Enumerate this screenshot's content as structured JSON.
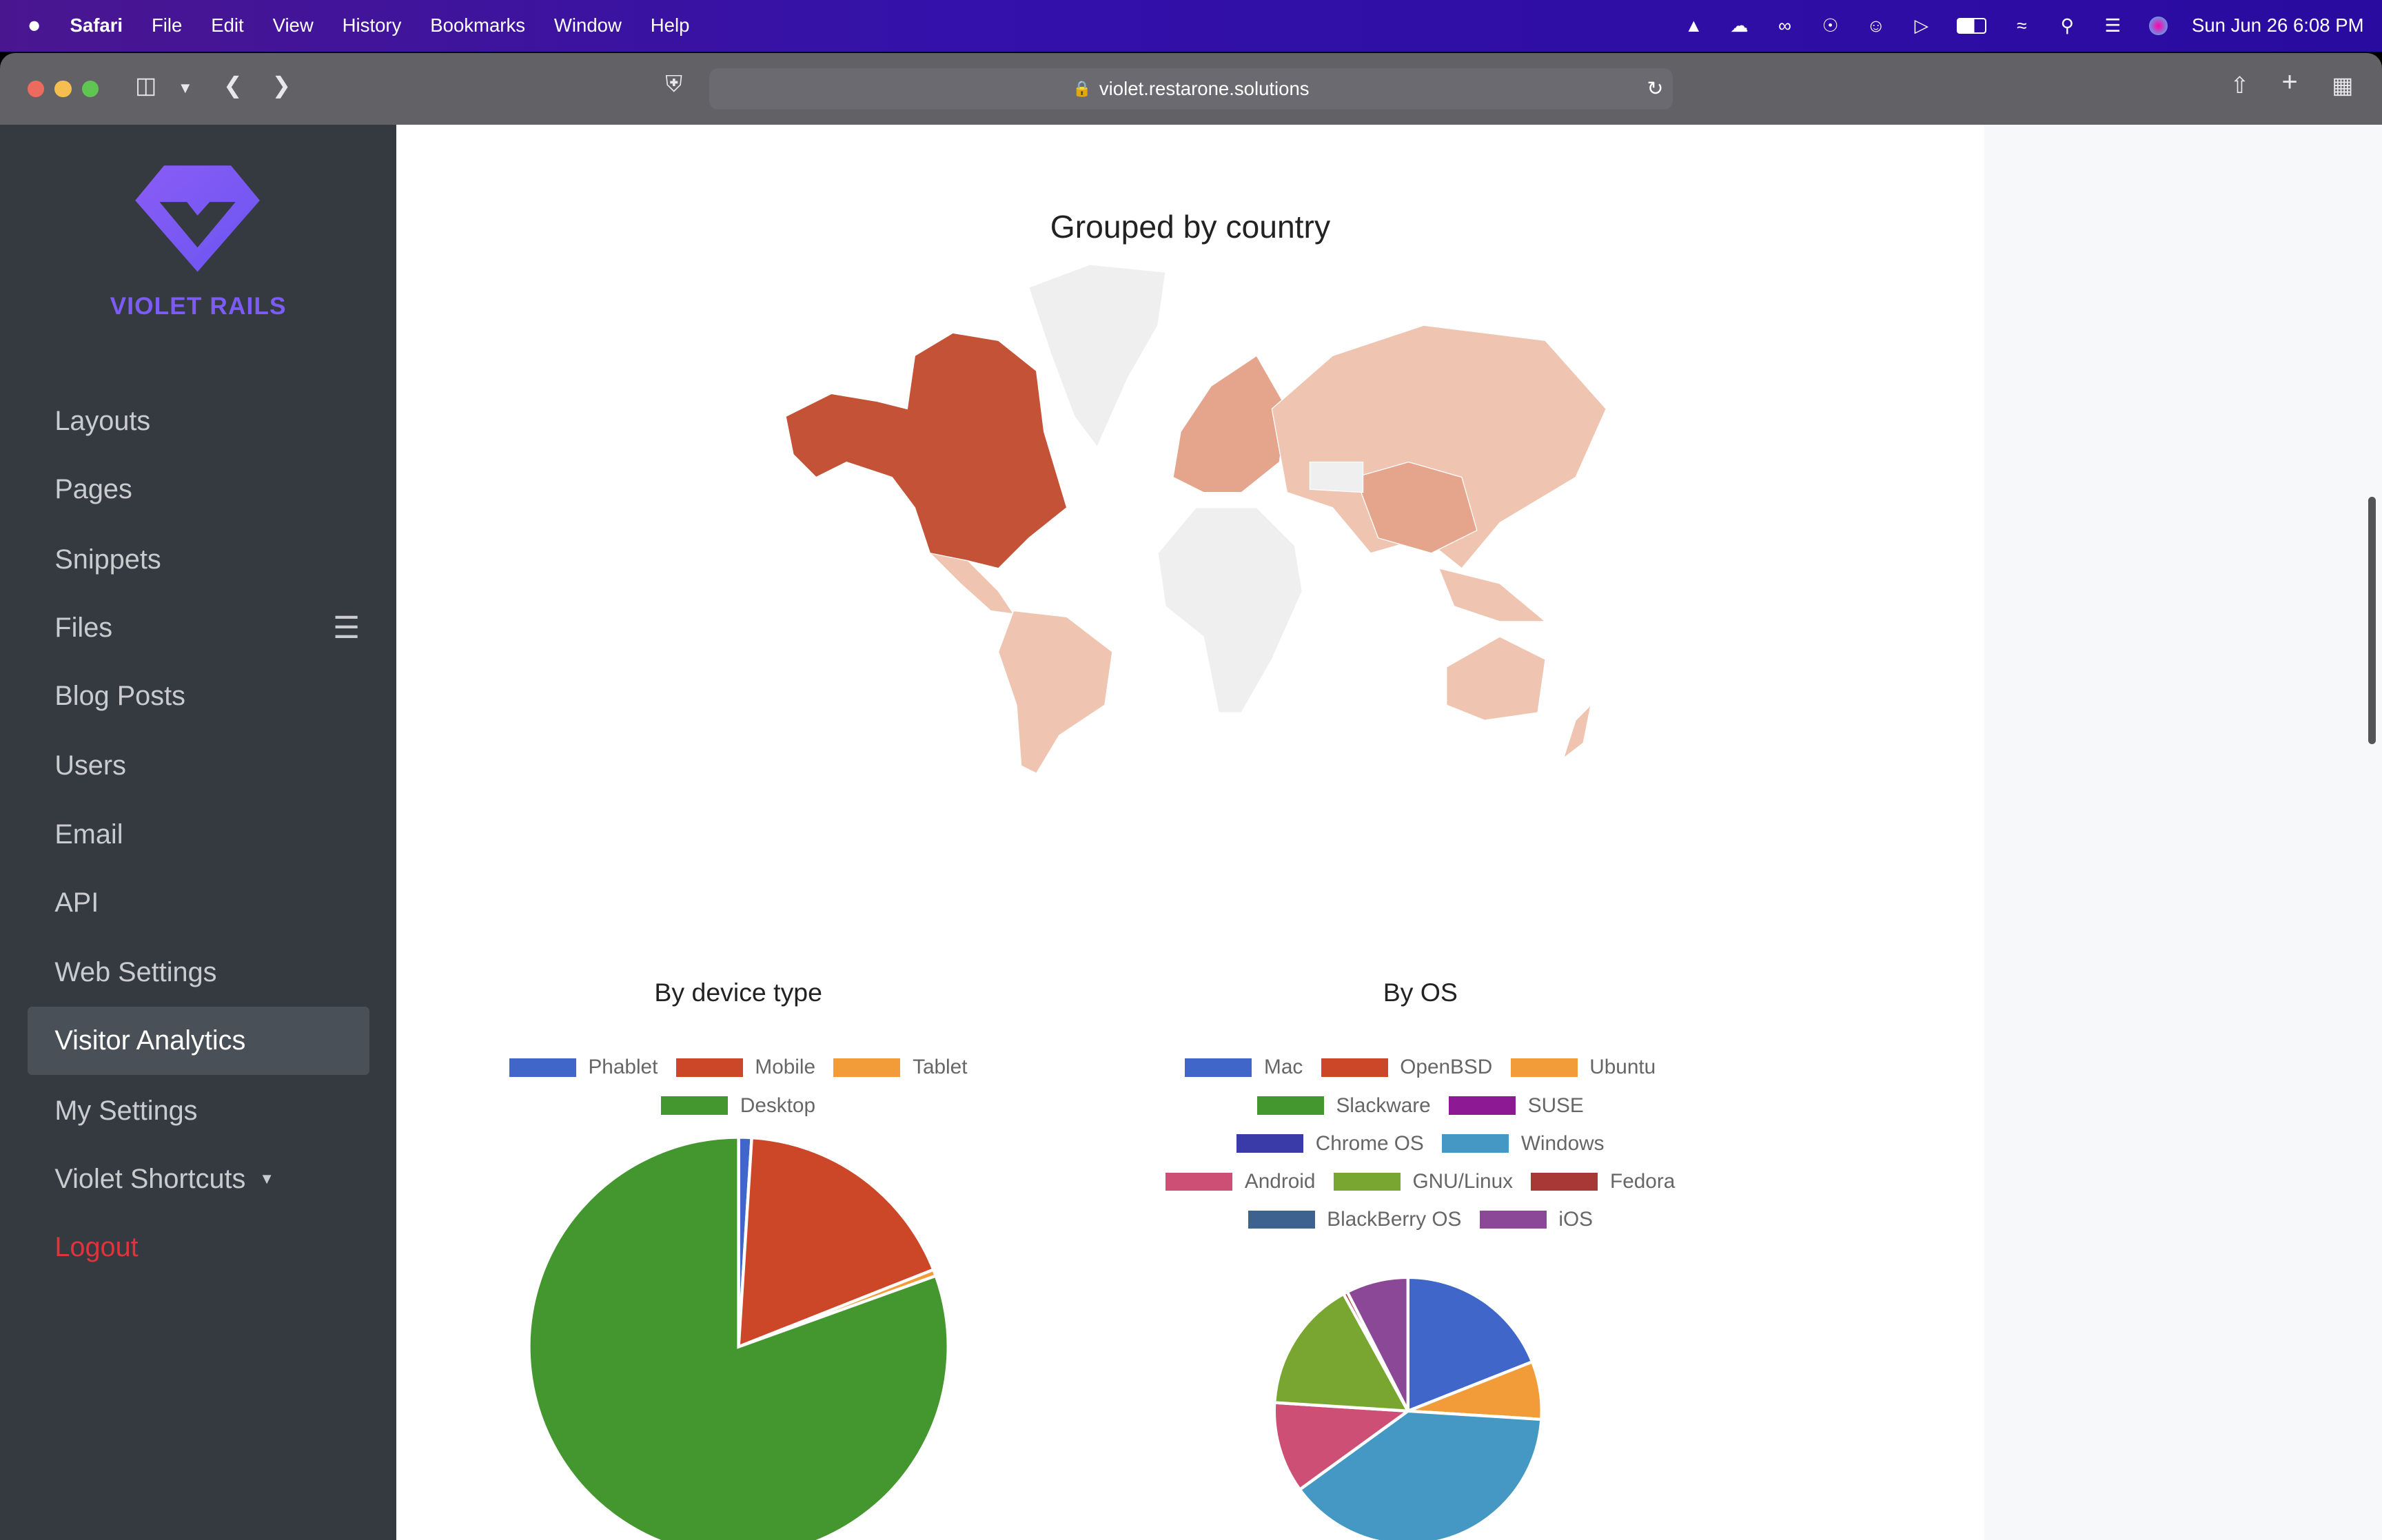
{
  "menubar": {
    "apple": "",
    "app": "Safari",
    "items": [
      "File",
      "Edit",
      "View",
      "History",
      "Bookmarks",
      "Window",
      "Help"
    ],
    "clock": "Sun Jun 26  6:08 PM",
    "status_icons": [
      "vlc-icon",
      "cloud-sync-icon",
      "glasses-icon",
      "onepassword-icon",
      "user-icon",
      "play-icon",
      "battery-icon",
      "wifi-icon",
      "search-icon",
      "control-center-icon",
      "siri-icon"
    ]
  },
  "browser": {
    "url": "violet.restarone.solutions"
  },
  "sidebar": {
    "brand": "VIOLET RAILS",
    "brand_color": "#7c5cf5",
    "items": [
      {
        "label": "Layouts"
      },
      {
        "label": "Pages"
      },
      {
        "label": "Snippets"
      },
      {
        "label": "Files"
      },
      {
        "label": "Blog Posts"
      },
      {
        "label": "Users"
      },
      {
        "label": "Email"
      },
      {
        "label": "API"
      },
      {
        "label": "Web Settings"
      },
      {
        "label": "Visitor Analytics",
        "active": true
      },
      {
        "label": "My Settings"
      },
      {
        "label": "Violet Shortcuts"
      },
      {
        "label": "Logout"
      }
    ]
  },
  "map": {
    "title": "Grouped by country",
    "color_scale": [
      "#f0f0f0",
      "#efc4b0",
      "#c45236"
    ]
  },
  "chart_data": [
    {
      "type": "pie",
      "title": "By device type",
      "categories": [
        "Phablet",
        "Mobile",
        "Tablet",
        "Desktop"
      ],
      "values": [
        1,
        18,
        0.5,
        80.5
      ],
      "colors": [
        "#3f66c8",
        "#cc4628",
        "#f19c38",
        "#44962f"
      ]
    },
    {
      "type": "pie",
      "title": "By OS",
      "categories": [
        "Mac",
        "OpenBSD",
        "Ubuntu",
        "Slackware",
        "SUSE",
        "Chrome OS",
        "Windows",
        "Android",
        "GNU/Linux",
        "Fedora",
        "BlackBerry OS",
        "iOS"
      ],
      "values": [
        19,
        0,
        7,
        0,
        0,
        0,
        39,
        11,
        16,
        0.5,
        0,
        7.5
      ],
      "colors": [
        "#3f66c8",
        "#cc4628",
        "#f19c38",
        "#44962f",
        "#8d1994",
        "#3a3ba8",
        "#4498c3",
        "#cd4f76",
        "#78a631",
        "#a83835",
        "#3d6290",
        "#8b4896"
      ]
    }
  ]
}
